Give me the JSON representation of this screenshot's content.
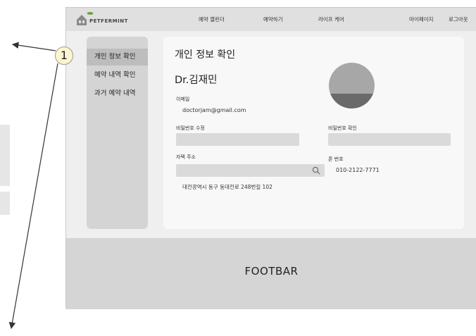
{
  "navbar": {
    "logo_text": "PETFERMINT",
    "links": [
      "예약 캘린더",
      "예약하기",
      "라이프 케어",
      "마이페이지",
      "로그아웃"
    ]
  },
  "sidebar": {
    "items": [
      {
        "label": "개인 정보 확인",
        "active": true
      },
      {
        "label": "예약 내역 확인",
        "active": false
      },
      {
        "label": "과거 예약 내역",
        "active": false
      }
    ]
  },
  "profile": {
    "page_title": "개인 정보 확인",
    "name": "Dr.김재민",
    "email_label": "이메일",
    "email_value": "doctorjam@gmail.com",
    "password_edit_label": "비밀번호 수정",
    "password_edit_value": "",
    "password_confirm_label": "비밀번호 확인",
    "password_confirm_value": "",
    "address_label": "자택 주소",
    "address_input_value": "",
    "address_value": "대전광역시 동구 동대전로 248번길 102",
    "phone_label": "폰 번호",
    "phone_value": "010-2122-7771"
  },
  "footer": {
    "text": "FOOTBAR"
  },
  "annotation": {
    "number": "1"
  },
  "colors": {
    "navbar_bg": "#e0e0e0",
    "sidebar_bg": "#d4d4d4",
    "sidebar_active": "#bdbdbd",
    "footer_bg": "#d5d5d5",
    "annotation_fill": "#fdf5cf"
  }
}
